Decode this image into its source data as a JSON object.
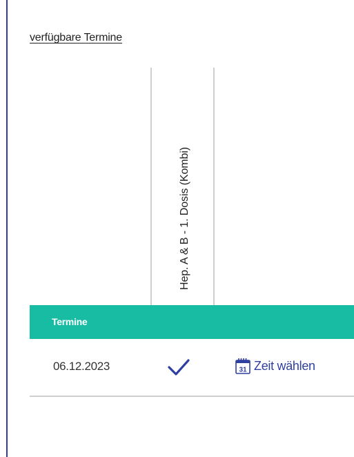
{
  "section": {
    "title": "verfügbare Termine"
  },
  "column_header": {
    "vaccine": "Hep. A & B - 1. Dosis (Kombi)"
  },
  "table": {
    "header_label": "Termine",
    "rows": [
      {
        "date": "06.12.2023",
        "available": true,
        "action_label": "Zeit wählen",
        "action_icon": "calendar-icon",
        "calendar_day": "31"
      }
    ]
  },
  "colors": {
    "accent": "#17bca3",
    "link": "#2f3f9f",
    "left_rule": "#2f3f9f"
  }
}
